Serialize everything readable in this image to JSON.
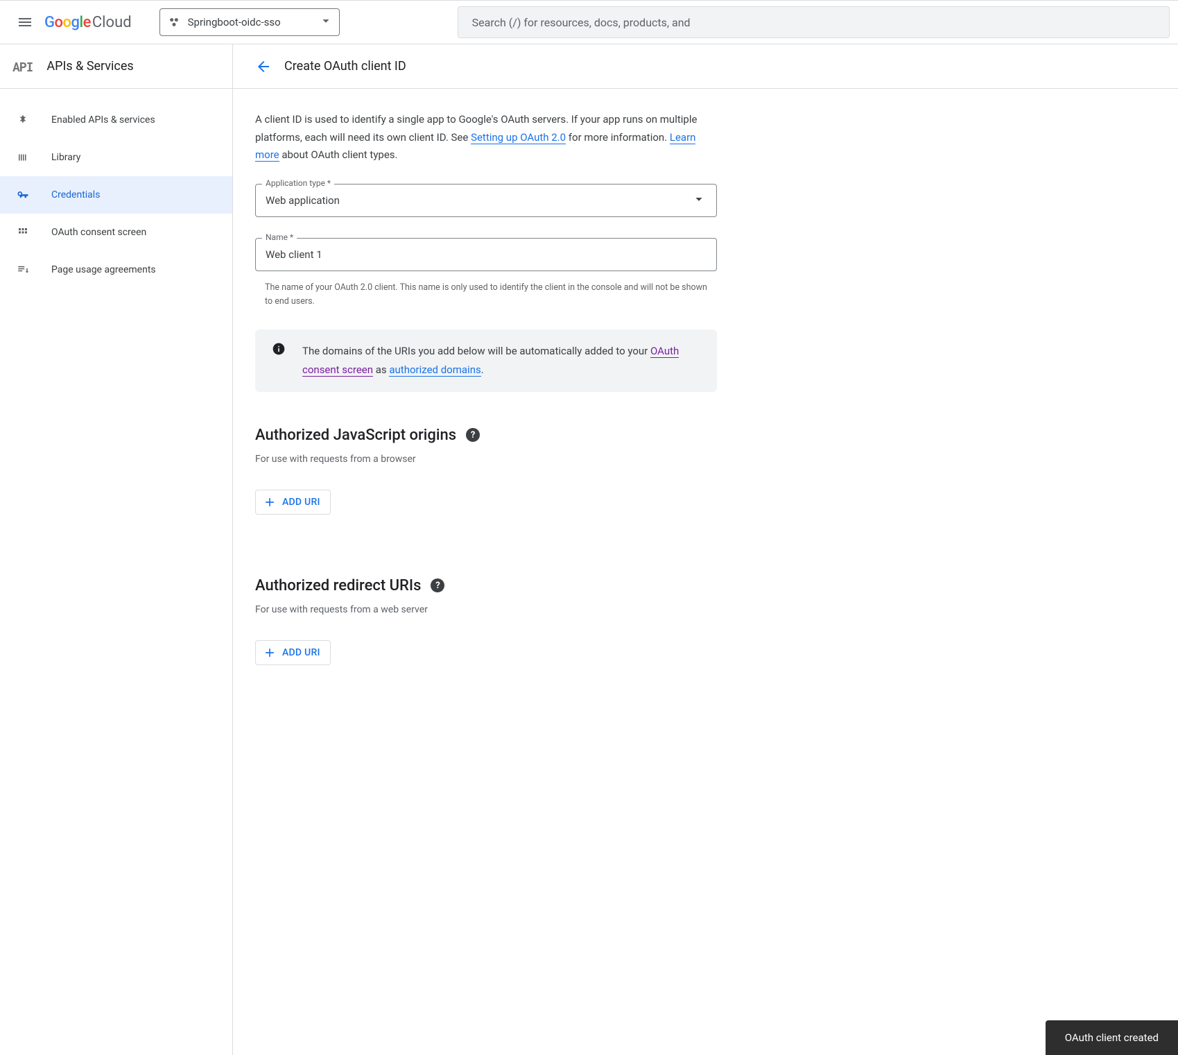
{
  "topbar": {
    "logo_cloud": "Cloud",
    "project_name": "Springboot-oidc-sso",
    "search_placeholder": "Search (/) for resources, docs, products, and"
  },
  "subheader": {
    "section": "APIs & Services",
    "page_title": "Create OAuth client ID"
  },
  "sidebar": {
    "items": [
      {
        "label": "Enabled APIs & services"
      },
      {
        "label": "Library"
      },
      {
        "label": "Credentials"
      },
      {
        "label": "OAuth consent screen"
      },
      {
        "label": "Page usage agreements"
      }
    ]
  },
  "intro": {
    "text1": "A client ID is used to identify a single app to Google's OAuth servers. If your app runs on multiple platforms, each will need its own client ID. See ",
    "link1": "Setting up OAuth 2.0",
    "text2": " for more information. ",
    "link2": "Learn more",
    "text3": " about OAuth client types."
  },
  "form": {
    "app_type_label": "Application type *",
    "app_type_value": "Web application",
    "name_label": "Name *",
    "name_value": "Web client 1",
    "name_help": "The name of your OAuth 2.0 client. This name is only used to identify the client in the console and will not be shown to end users."
  },
  "info": {
    "text1": "The domains of the URIs you add below will be automatically added to your ",
    "link1": "OAuth consent screen",
    "text2": " as ",
    "link2": "authorized domains",
    "text3": "."
  },
  "js_origins": {
    "title": "Authorized JavaScript origins",
    "subtitle": "For use with requests from a browser",
    "add_label": "ADD URI"
  },
  "redirect_uris": {
    "title": "Authorized redirect URIs",
    "subtitle": "For use with requests from a web server",
    "add_label": "ADD URI"
  },
  "toast": {
    "message": "OAuth client created"
  }
}
